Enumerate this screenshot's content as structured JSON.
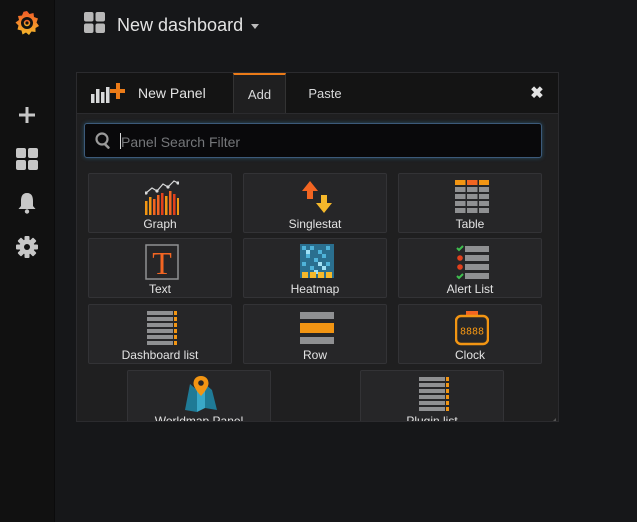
{
  "app": {
    "title": "New dashboard"
  },
  "sidebar": {
    "items": [
      {
        "icon": "grafana-logo-icon"
      },
      {
        "icon": "plus-icon"
      },
      {
        "icon": "dashboards-icon"
      },
      {
        "icon": "bell-icon"
      },
      {
        "icon": "gear-icon"
      }
    ]
  },
  "panel": {
    "title": "New Panel",
    "tabs": [
      "Add",
      "Paste"
    ],
    "active_tab": "Add",
    "close_glyph": "✖",
    "search": {
      "placeholder": "Panel Search Filter",
      "value": ""
    },
    "tiles": [
      {
        "label": "Graph",
        "icon": "graph-icon"
      },
      {
        "label": "Singlestat",
        "icon": "singlestat-icon"
      },
      {
        "label": "Table",
        "icon": "table-icon"
      },
      {
        "label": "Text",
        "icon": "text-icon"
      },
      {
        "label": "Heatmap",
        "icon": "heatmap-icon"
      },
      {
        "label": "Alert List",
        "icon": "alert-list-icon"
      },
      {
        "label": "Dashboard list",
        "icon": "dashboard-list-icon"
      },
      {
        "label": "Row",
        "icon": "row-icon"
      },
      {
        "label": "Clock",
        "icon": "clock-icon"
      },
      {
        "label": "Worldmap Panel",
        "icon": "worldmap-icon"
      },
      {
        "label": "Plugin list",
        "icon": "plugin-list-icon"
      }
    ]
  },
  "colors": {
    "accent": "#eb7b18",
    "background": "#161719",
    "panel": "#1f1f20",
    "tile": "#262628"
  }
}
